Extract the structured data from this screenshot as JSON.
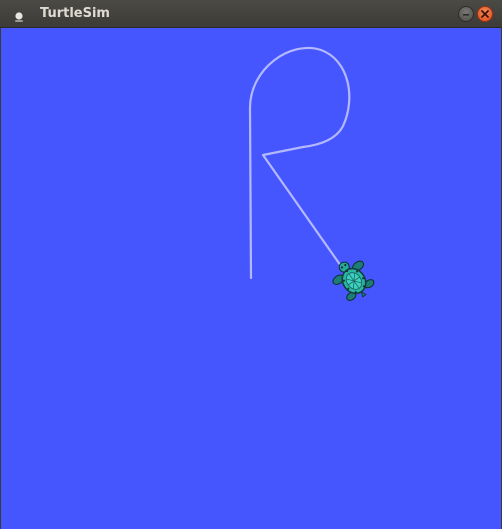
{
  "window": {
    "title": "TurtleSim"
  },
  "icons": {
    "app": "turtlesim-app-icon",
    "minimize": "minimize-icon",
    "close": "close-icon",
    "turtle": "turtle-icon"
  },
  "colors": {
    "background": "#4556ff",
    "pen": "#b3b8ff",
    "titlebar": "#3c3b37",
    "close": "#e2531d"
  }
}
